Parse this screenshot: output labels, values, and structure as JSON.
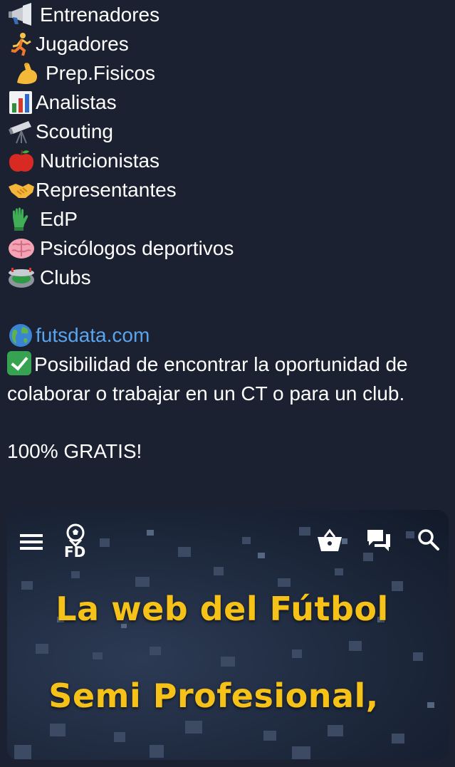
{
  "roles": [
    {
      "icon": "megaphone-icon",
      "label": "Entrenadores"
    },
    {
      "icon": "runner-icon",
      "label": "Jugadores"
    },
    {
      "icon": "flexed-biceps-icon",
      "label": "Prep.Fisicos"
    },
    {
      "icon": "bar-chart-icon",
      "label": "Analistas"
    },
    {
      "icon": "telescope-icon",
      "label": "Scouting"
    },
    {
      "icon": "red-apple-icon",
      "label": "Nutricionistas"
    },
    {
      "icon": "handshake-icon",
      "label": "Representantes"
    },
    {
      "icon": "goalkeeper-glove-icon",
      "label": "EdP"
    },
    {
      "icon": "brain-icon",
      "label": "Psicólogos deportivos"
    },
    {
      "icon": "stadium-icon",
      "label": "Clubs"
    }
  ],
  "website": {
    "icon": "globe-icon",
    "label": "futsdata.com"
  },
  "benefit": {
    "icon": "check-mark-icon",
    "text": "Posibilidad de encontrar la oportunidad de colaborar o trabajar en un CT o para un club."
  },
  "price_note": "100% GRATIS!",
  "preview": {
    "logo_text": "FD",
    "headline_1": "La web del Fútbol",
    "headline_2": "Semi Profesional,"
  },
  "colors": {
    "background": "#1b2130",
    "link": "#5aa4ec",
    "headline": "#f7c218"
  }
}
